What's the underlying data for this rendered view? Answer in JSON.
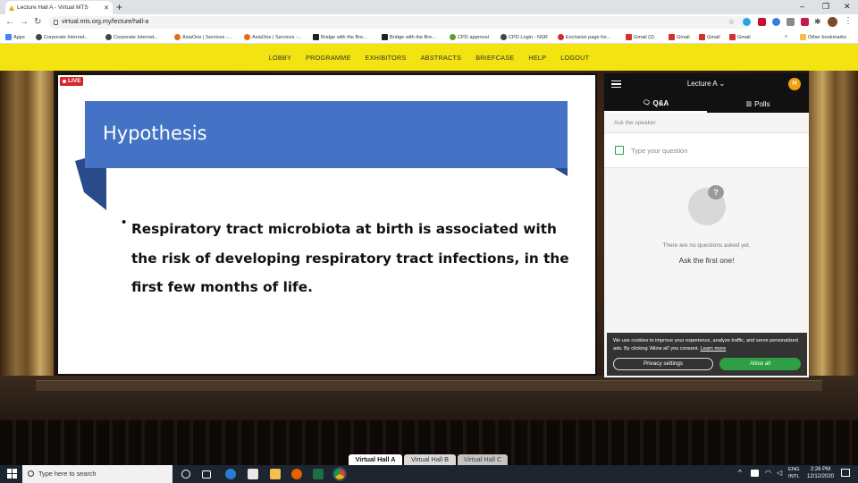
{
  "browser": {
    "tab_title": "Lecture Hall A - Virtual MTS",
    "new_tab": "+",
    "url": "virtual.mts.org.my/lecture/hall-a",
    "window_controls": [
      "–",
      "❐",
      "✕"
    ],
    "bookmarks": [
      {
        "label": "Apps",
        "color": "#4285f4"
      },
      {
        "label": "Corporate Internet...",
        "color": "#444444"
      },
      {
        "label": "Corporate Internet...",
        "color": "#444444"
      },
      {
        "label": "AsiaOne | Services -...",
        "color": "#e26b1c"
      },
      {
        "label": "AsiaOne | Services -...",
        "color": "#e26b1c"
      },
      {
        "label": "Bridge with the Bre...",
        "color": "#222222"
      },
      {
        "label": "Bridge with the Bre...",
        "color": "#222222"
      },
      {
        "label": "CPD approval",
        "color": "#5a9e2f"
      },
      {
        "label": "CPD Login - NSR",
        "color": "#444444"
      },
      {
        "label": "Exclusive page for...",
        "color": "#d92b2b"
      },
      {
        "label": "Gmail (2)",
        "color": "#d93025"
      },
      {
        "label": "Gmail",
        "color": "#d93025"
      },
      {
        "label": "Gmail",
        "color": "#d93025"
      },
      {
        "label": "Gmail",
        "color": "#d93025"
      }
    ],
    "bookmarks_more": "»",
    "other_bookmarks": "Other bookmarks"
  },
  "nav": {
    "items": [
      "LOBBY",
      "PROGRAMME",
      "EXHIBITORS",
      "ABSTRACTS",
      "BRIEFCASE",
      "HELP",
      "LOGOUT"
    ],
    "bg_color": "#f2e311"
  },
  "slide": {
    "live_badge": "LIVE",
    "title": "Hypothesis",
    "bullet": "•",
    "text": "Respiratory tract microbiota at birth is associated with the risk of  developing respiratory tract infections, in the first few months of life.",
    "accent_color": "#4472c4"
  },
  "panel": {
    "lecture_title": "Lecture A",
    "lecture_caret": "⌄",
    "avatar_initial": "H",
    "tab_qa": "Q&A",
    "tab_polls": "Polls",
    "ask_label": "Ask the speaker",
    "question_placeholder": "Type your question",
    "empty_message": "There are no questions asked yet.",
    "empty_cta": "Ask the first one!",
    "cookie_text": "We use cookies to improve your experience, analyze traffic, and serve personalized ads. By clicking 'Allow all' you consent.",
    "cookie_link": "Learn more",
    "privacy_button": "Privacy settings",
    "allow_button": "Allow all",
    "allow_color": "#2ea043"
  },
  "halls": [
    "Virtual Hall A",
    "Virtual Hall B",
    "Virtual Hall C"
  ],
  "taskbar": {
    "search_placeholder": "Type here to search",
    "lang_top": "ENG",
    "lang_bottom": "INTL",
    "time": "2:26 PM",
    "date": "12/12/2020"
  }
}
